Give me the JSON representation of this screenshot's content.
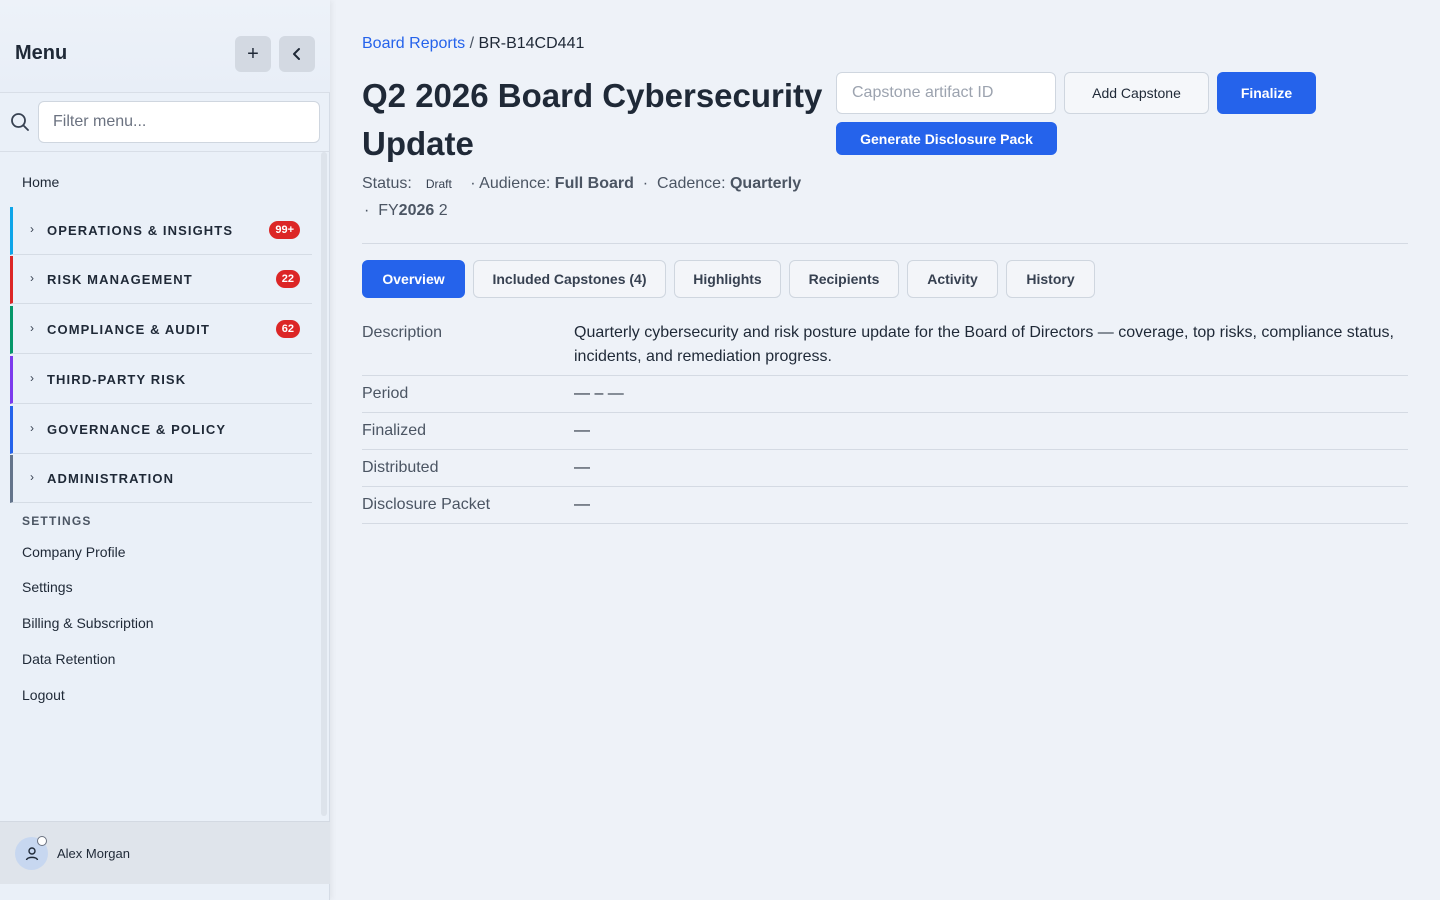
{
  "sidebar": {
    "title": "Menu",
    "add_icon": "plus-icon",
    "collapse_icon": "chevron-left-icon",
    "filter_placeholder": "Filter menu...",
    "home": "Home",
    "groups": [
      {
        "label": "OPERATIONS & INSIGHTS",
        "badge": "99+",
        "color": "#0ea5e9"
      },
      {
        "label": "RISK MANAGEMENT",
        "badge": "22",
        "color": "#dc2626"
      },
      {
        "label": "COMPLIANCE & AUDIT",
        "badge": "62",
        "color": "#059669"
      },
      {
        "label": "THIRD-PARTY RISK",
        "badge": "",
        "color": "#7c3aed"
      },
      {
        "label": "GOVERNANCE & POLICY",
        "badge": "",
        "color": "#2563eb"
      },
      {
        "label": "ADMINISTRATION",
        "badge": "",
        "color": "#64748b"
      }
    ],
    "settings_section": "SETTINGS",
    "links": [
      "Company Profile",
      "Settings",
      "Billing & Subscription",
      "Data Retention",
      "Logout"
    ],
    "user": {
      "name": "Alex Morgan"
    }
  },
  "breadcrumb": {
    "parent": "Board Reports",
    "separator": "/",
    "current": "BR-B14CD441"
  },
  "page": {
    "title": "Q2 2026 Board Cybersecurity Update",
    "status_label": "Status:",
    "status_value": "Draft",
    "audience_label": "Audience:",
    "audience_value": "Full Board",
    "cadence_label": "Cadence:",
    "cadence_value": "Quarterly",
    "fy_prefix": "FY",
    "fy_year": "2026",
    "fy_suffix": "2",
    "dot": "·"
  },
  "actions": {
    "capstone_placeholder": "Capstone artifact ID",
    "add_capstone": "Add Capstone",
    "finalize": "Finalize",
    "generate": "Generate Disclosure Pack"
  },
  "tabs": [
    "Overview",
    "Included Capstones (4)",
    "Highlights",
    "Recipients",
    "Activity",
    "History"
  ],
  "details": [
    {
      "label": "Description",
      "value": "Quarterly cybersecurity and risk posture update for the Board of Directors — coverage, top risks, compliance status, incidents, and remediation progress."
    },
    {
      "label": "Period",
      "value": "— – —"
    },
    {
      "label": "Finalized",
      "value": "—"
    },
    {
      "label": "Distributed",
      "value": "—"
    },
    {
      "label": "Disclosure Packet",
      "value": "—"
    }
  ]
}
